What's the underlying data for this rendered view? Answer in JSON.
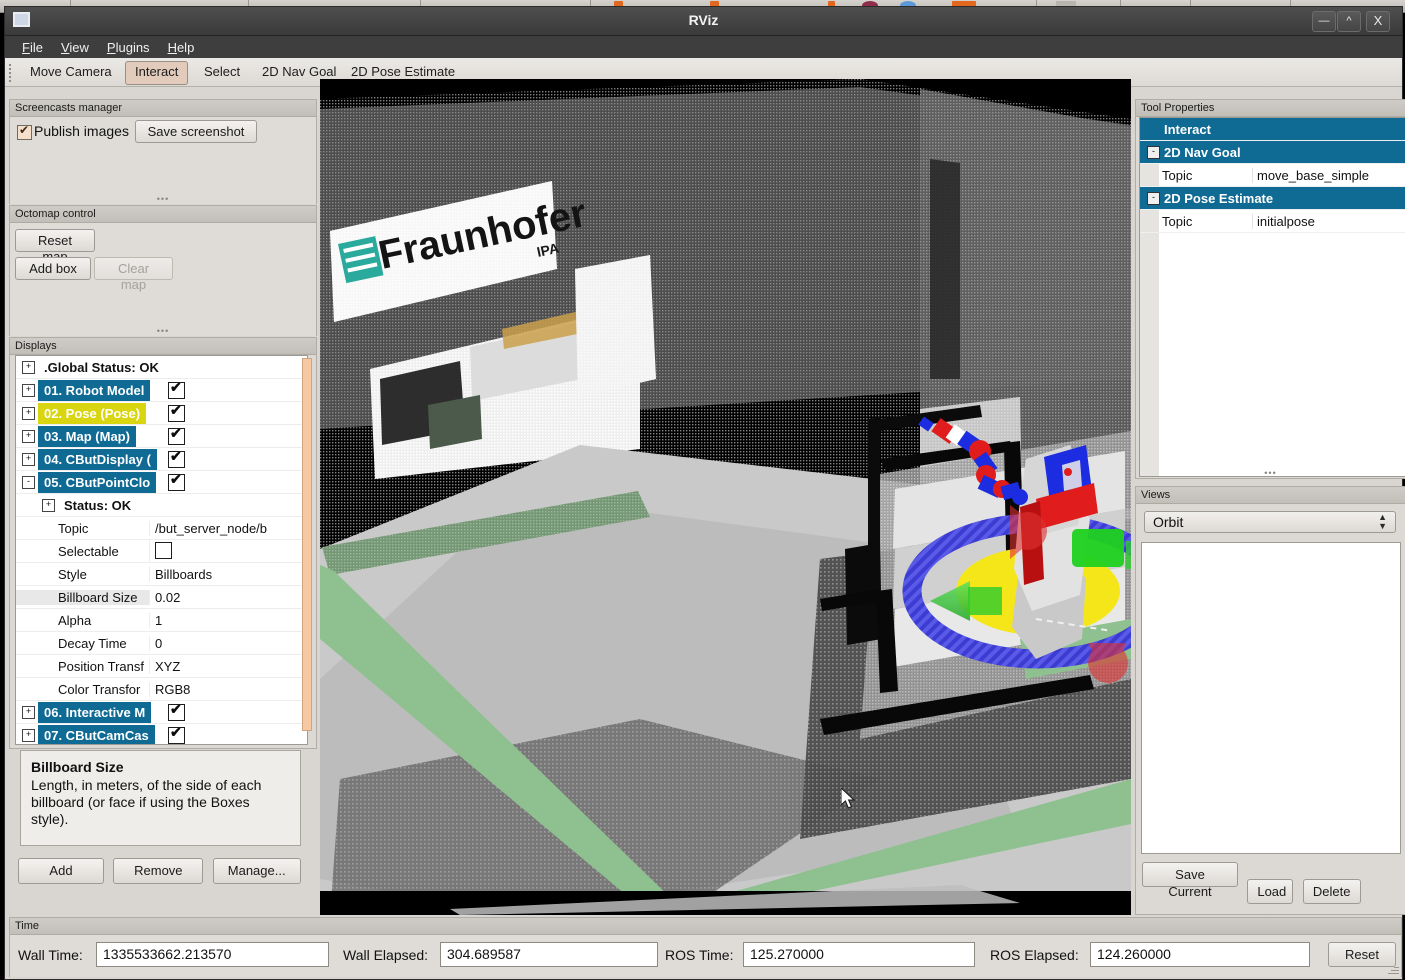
{
  "window": {
    "title": "RViz",
    "buttons": {
      "minimize": "—",
      "maximize": "^",
      "close": "X"
    }
  },
  "menubar": [
    {
      "label": "File",
      "accel": "F"
    },
    {
      "label": "View",
      "accel": "V"
    },
    {
      "label": "Plugins",
      "accel": "P"
    },
    {
      "label": "Help",
      "accel": "H"
    }
  ],
  "toolbar": {
    "items": [
      {
        "label": "Move Camera",
        "active": false
      },
      {
        "label": "Interact",
        "active": true
      },
      {
        "label": "Select",
        "active": false
      },
      {
        "label": "2D Nav Goal",
        "active": false
      },
      {
        "label": "2D Pose Estimate",
        "active": false
      }
    ]
  },
  "screencasts": {
    "title": "Screencasts manager",
    "publish_images_label": "Publish images",
    "publish_images_checked": true,
    "save_screenshot_label": "Save screenshot"
  },
  "octomap": {
    "title": "Octomap control",
    "reset_map_label": "Reset map",
    "add_box_label": "Add box",
    "clear_map_label": "Clear map",
    "clear_map_enabled": false
  },
  "displays": {
    "title": "Displays",
    "rows": [
      {
        "kind": "plain",
        "expander": "+",
        "label": ".Global Status: OK"
      },
      {
        "kind": "header",
        "expander": "+",
        "label": "01. Robot Model",
        "checked": true,
        "selected": false
      },
      {
        "kind": "header",
        "expander": "+",
        "label": "02. Pose (Pose)",
        "checked": true,
        "selected": true
      },
      {
        "kind": "header",
        "expander": "+",
        "label": "03. Map (Map)",
        "checked": true,
        "selected": false
      },
      {
        "kind": "header",
        "expander": "+",
        "label": "04. CButDisplay (",
        "checked": true,
        "selected": false
      },
      {
        "kind": "header",
        "expander": "-",
        "label": "05. CButPointClo",
        "checked": true,
        "selected": false
      },
      {
        "kind": "sub",
        "expander": "+",
        "label": "Status: OK"
      },
      {
        "kind": "prop",
        "name": "Topic",
        "value": "/but_server_node/b"
      },
      {
        "kind": "propcheck",
        "name": "Selectable",
        "value": "",
        "checked": false
      },
      {
        "kind": "prop",
        "name": "Style",
        "value": "Billboards"
      },
      {
        "kind": "prop",
        "name": "Billboard Size",
        "value": "0.02"
      },
      {
        "kind": "prop",
        "name": "Alpha",
        "value": "1"
      },
      {
        "kind": "prop",
        "name": "Decay Time",
        "value": "0"
      },
      {
        "kind": "prop",
        "name": "Position Transf",
        "value": "XYZ"
      },
      {
        "kind": "prop",
        "name": "Color Transfor",
        "value": "RGB8"
      },
      {
        "kind": "header",
        "expander": "+",
        "label": "06. Interactive M",
        "checked": true,
        "selected": false
      },
      {
        "kind": "header",
        "expander": "+",
        "label": "07. CButCamCas",
        "checked": true,
        "selected": false
      }
    ],
    "description": {
      "title": "Billboard Size",
      "text": "Length, in meters, of the side of each billboard (or face if using the Boxes style)."
    },
    "buttons": {
      "add": "Add",
      "remove": "Remove",
      "manage": "Manage..."
    }
  },
  "tool_properties": {
    "title": "Tool Properties",
    "rows": [
      {
        "kind": "header",
        "label": "Interact",
        "expander": ""
      },
      {
        "kind": "header",
        "label": "2D Nav Goal",
        "expander": "-"
      },
      {
        "kind": "prop",
        "name": "Topic",
        "value": "move_base_simple"
      },
      {
        "kind": "header",
        "label": "2D Pose Estimate",
        "expander": "-"
      },
      {
        "kind": "prop",
        "name": "Topic",
        "value": "initialpose"
      }
    ]
  },
  "views": {
    "title": "Views",
    "selected_mode": "Orbit",
    "buttons": {
      "save_current": "Save Current",
      "load": "Load",
      "delete": "Delete"
    }
  },
  "time": {
    "title": "Time",
    "fields": [
      {
        "label": "Wall Time:",
        "value": "1335533662.213570"
      },
      {
        "label": "Wall Elapsed:",
        "value": "304.689587"
      },
      {
        "label": "ROS Time:",
        "value": "125.270000"
      },
      {
        "label": "ROS Elapsed:",
        "value": "124.260000"
      }
    ],
    "reset_label": "Reset"
  },
  "view3d": {
    "banner_text": "Fraunhofer",
    "banner_sub": "IPA",
    "colors": {
      "background": "#000000",
      "banner_logo": "#17a394",
      "marker_ring": "#3c3cd2",
      "marker_disc": "#f5e61a",
      "marker_arrow": "#2ecc2e",
      "marker_cone": "#e03030",
      "robot_body": "#d8d8d8",
      "robot_accent_red": "#e01c1c",
      "robot_accent_blue": "#1c2ce0",
      "wall_green": "#7fb87f"
    }
  }
}
